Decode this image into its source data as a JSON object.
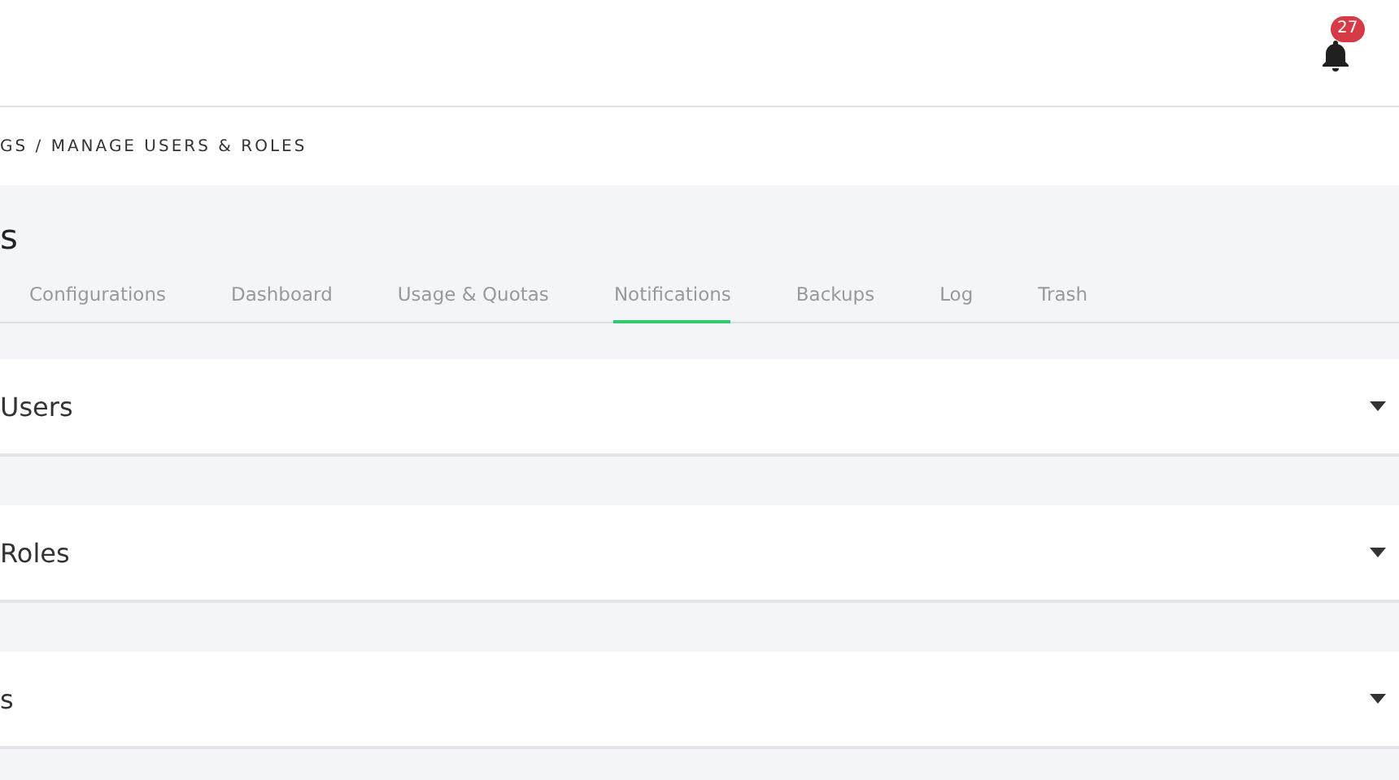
{
  "header": {
    "notification_count": "27"
  },
  "breadcrumb": "GS / MANAGE USERS & ROLES",
  "page_title": "s",
  "tabs": [
    {
      "label": "Configurations",
      "selected": false
    },
    {
      "label": "Dashboard",
      "selected": false
    },
    {
      "label": "Usage & Quotas",
      "selected": false
    },
    {
      "label": "Notifications",
      "selected": true
    },
    {
      "label": "Backups",
      "selected": false
    },
    {
      "label": "Log",
      "selected": false
    },
    {
      "label": "Trash",
      "selected": false
    }
  ],
  "panels": [
    {
      "title": "Users",
      "expanded": false
    },
    {
      "title": "Roles",
      "expanded": false
    },
    {
      "title": "s",
      "expanded": false
    }
  ]
}
